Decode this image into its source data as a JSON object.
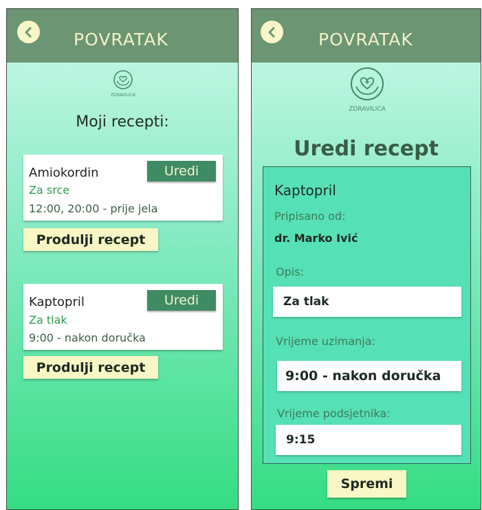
{
  "back_label": "POVRATAK",
  "logo_text": "ZDRAVILICA",
  "list_screen": {
    "title": "Moji recepti:",
    "prescriptions": [
      {
        "name": "Amiokordin",
        "description": "Za srce",
        "schedule": "12:00, 20:00 - prije jela",
        "edit_label": "Uredi",
        "extend_label": "Produlji recept"
      },
      {
        "name": "Kaptopril",
        "description": "Za tlak",
        "schedule": "9:00 - nakon doručka",
        "edit_label": "Uredi",
        "extend_label": "Produlji recept"
      }
    ]
  },
  "edit_screen": {
    "title": "Uredi recept",
    "medicine_name": "Kaptopril",
    "prescribed_by_label": "Pripisano od:",
    "doctor": "dr. Marko Ivić",
    "description_label": "Opis:",
    "description_value": "Za tlak",
    "intake_time_label": "Vrijeme uzimanja:",
    "intake_time_value": "9:00 - nakon doručka",
    "reminder_time_label": "Vrijeme podsjetnika:",
    "reminder_time_value": "9:15",
    "save_label": "Spremi"
  },
  "colors": {
    "topbar": "#6b9573",
    "accent_green": "#3f8b63",
    "button_yellow": "#f9f7c5",
    "gradient_top": "#cdf8ea",
    "gradient_bottom": "#35dd83"
  },
  "icons": [
    "back-arrow-icon",
    "heart-hands-logo-icon"
  ]
}
